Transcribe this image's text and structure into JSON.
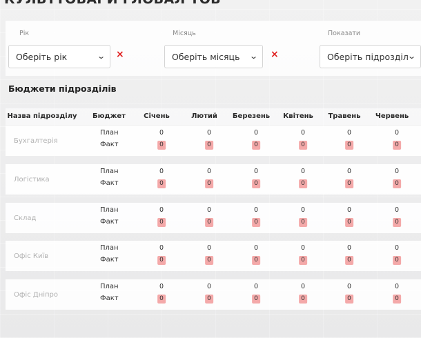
{
  "page": {
    "title": "КУЛЬТТОВАРИ ГЛОБАЛ ТОВ"
  },
  "filters": {
    "year": {
      "label": "Рік",
      "value": "Оберіть рік"
    },
    "month": {
      "label": "Місяць",
      "value": "Оберіть місяць"
    },
    "show": {
      "label": "Показати",
      "value": "Оберіть підрозділ"
    },
    "clear_symbol": "×"
  },
  "section": {
    "title": "Бюджети підрозділів"
  },
  "table": {
    "headers": {
      "department": "Назва підрозділу",
      "budget": "Бюджет",
      "months": [
        "Січень",
        "Лютий",
        "Березень",
        "Квітень",
        "Травень",
        "Червень"
      ]
    },
    "budget_labels": {
      "plan": "План",
      "fact": "Факт"
    },
    "rows": [
      {
        "name": "Бухгалтерія",
        "plan": [
          "0",
          "0",
          "0",
          "0",
          "0",
          "0"
        ],
        "fact": [
          "0",
          "0",
          "0",
          "0",
          "0",
          "0"
        ]
      },
      {
        "name": "Логістика",
        "plan": [
          "0",
          "0",
          "0",
          "0",
          "0",
          "0"
        ],
        "fact": [
          "0",
          "0",
          "0",
          "0",
          "0",
          "0"
        ]
      },
      {
        "name": "Склад",
        "plan": [
          "0",
          "0",
          "0",
          "0",
          "0",
          "0"
        ],
        "fact": [
          "0",
          "0",
          "0",
          "0",
          "0",
          "0"
        ]
      },
      {
        "name": "Офіс Київ",
        "plan": [
          "0",
          "0",
          "0",
          "0",
          "0",
          "0"
        ],
        "fact": [
          "0",
          "0",
          "0",
          "0",
          "0",
          "0"
        ]
      },
      {
        "name": "Офіс Дніпро",
        "plan": [
          "0",
          "0",
          "0",
          "0",
          "0",
          "0"
        ],
        "fact": [
          "0",
          "0",
          "0",
          "0",
          "0",
          "0"
        ]
      }
    ]
  },
  "colors": {
    "fact_badge": "#f4a9a9",
    "clear_icon": "#e02020",
    "dept_text": "#b1b1b1"
  },
  "icons": {
    "select_arrow": "chevron-down-icon",
    "clear": "close-icon"
  }
}
